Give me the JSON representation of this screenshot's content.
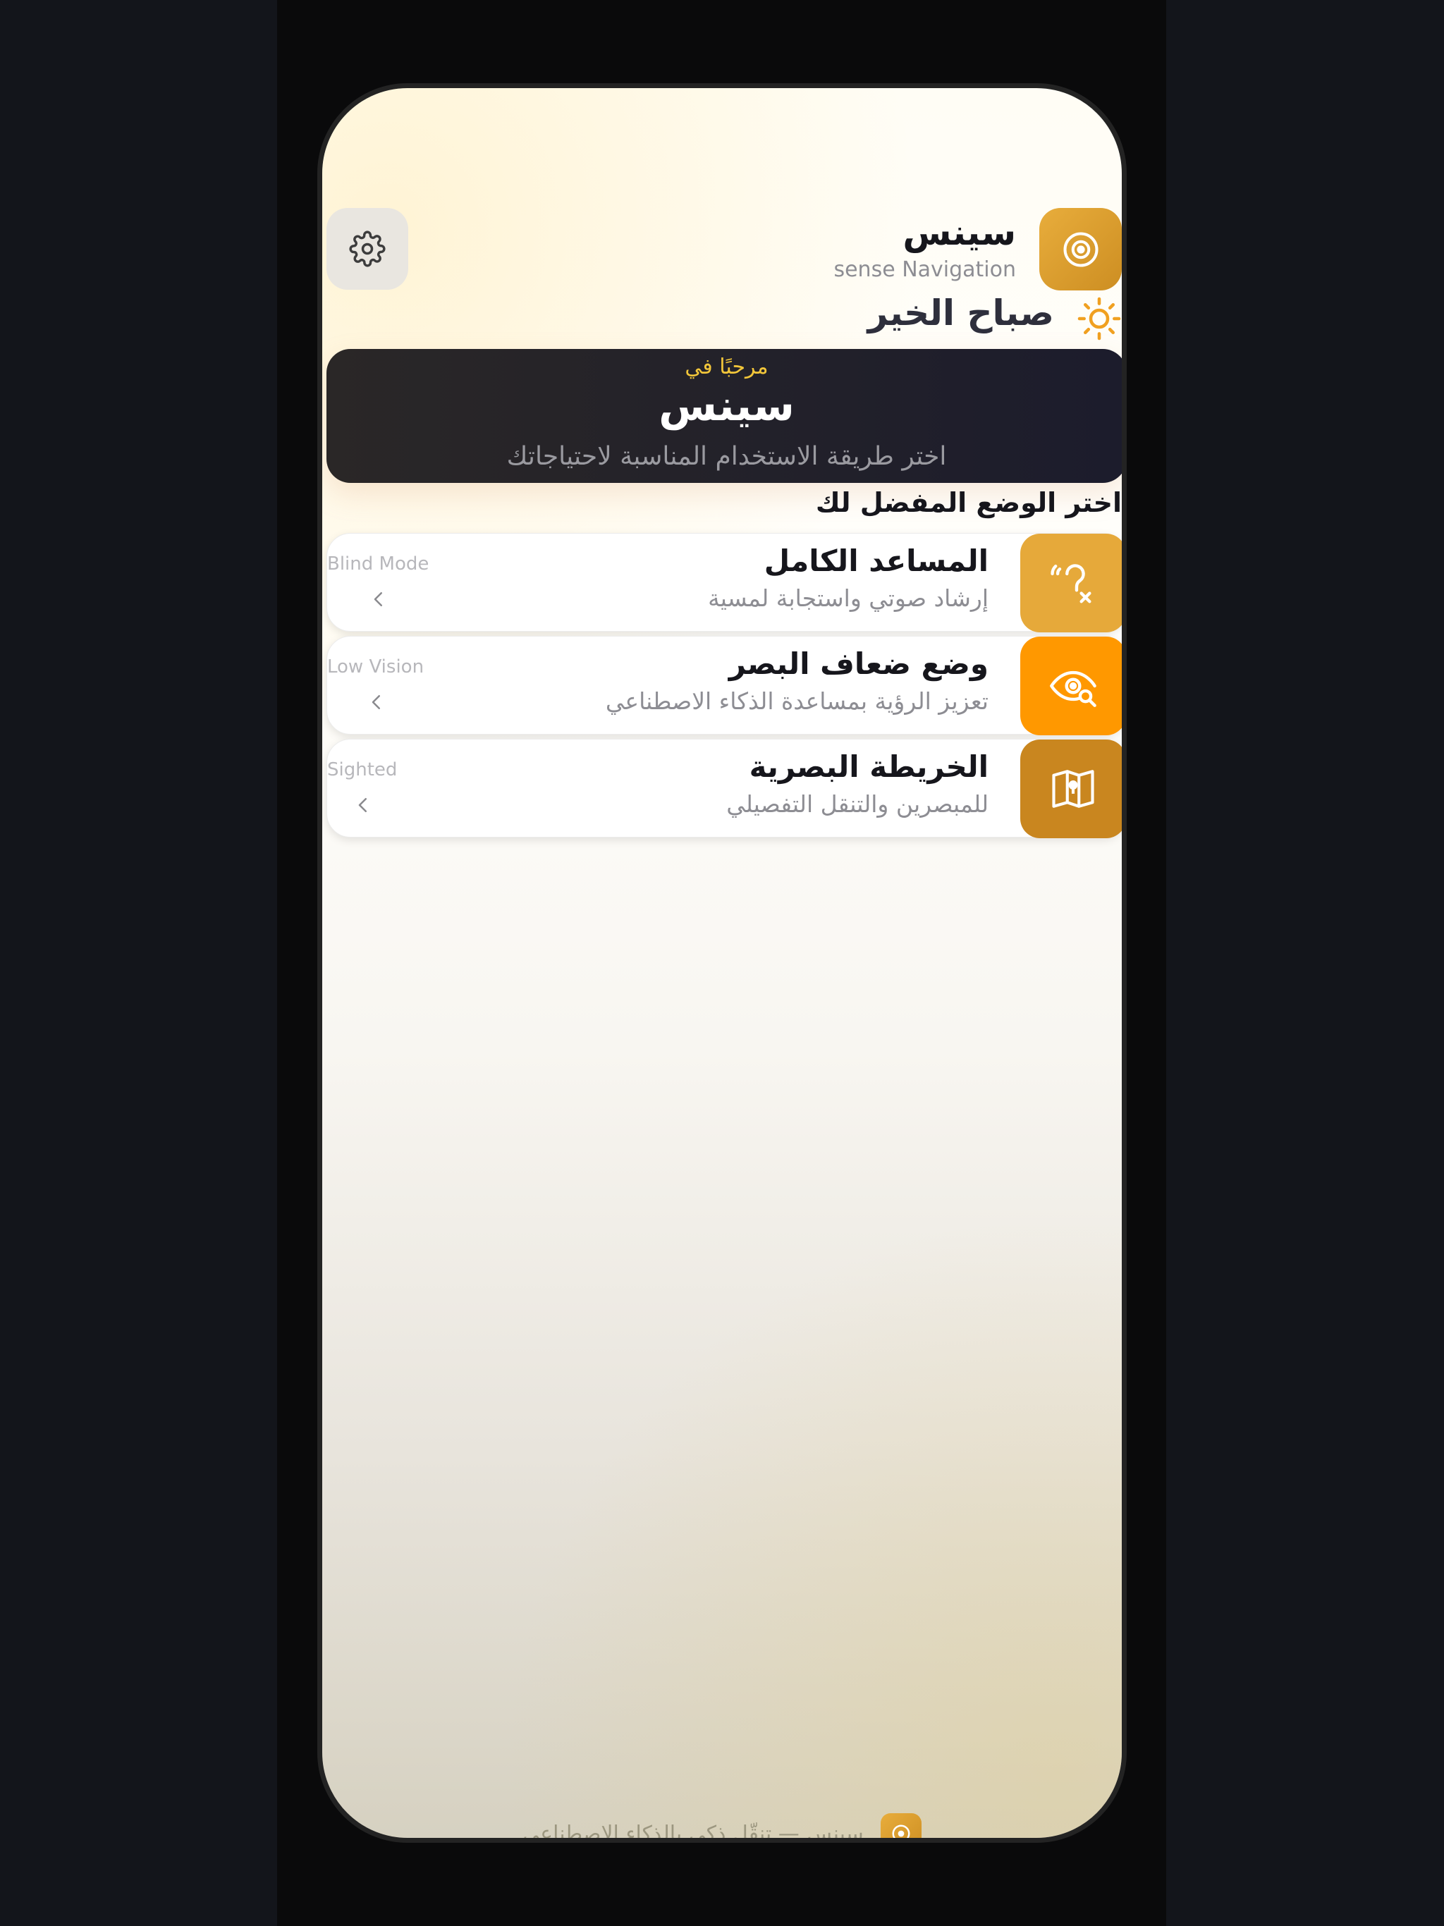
{
  "header": {
    "app_name": "سينس",
    "app_subtitle": "sense Navigation",
    "greeting": "صباح الخير",
    "settings_icon": "gear-icon",
    "logo_icon": "target-icon"
  },
  "hero": {
    "kicker": "مرحبًا في",
    "title": "سينس",
    "subtitle": "اختر طريقة الاستخدام المناسبة لاحتياجاتك"
  },
  "section_title": "اختر الوضع المفضل لك",
  "modes": [
    {
      "title": "المساعد الكامل",
      "description": "إرشاد صوتي واستجابة لمسية",
      "mode_label": "Blind Mode",
      "icon": "hearing-icon",
      "color": "#e6a93a"
    },
    {
      "title": "وضع ضعاف البصر",
      "description": "تعزيز الرؤية بمساعدة الذكاء الاصطناعي",
      "mode_label": "Low Vision",
      "icon": "eye-search-icon",
      "color": "#ff9800"
    },
    {
      "title": "الخريطة البصرية",
      "description": "للمبصرين والتنقل التفصيلي",
      "mode_label": "Sighted",
      "icon": "map-icon",
      "color": "#c9861f"
    }
  ],
  "footer": {
    "text": "سينس — تنقّل ذكي بالذكاء الاصطناعي",
    "icon": "target-icon"
  },
  "colors": {
    "accent": "#e8ad3c",
    "kicker": "#f2c63a",
    "hero_bg": "#1f1f26"
  }
}
